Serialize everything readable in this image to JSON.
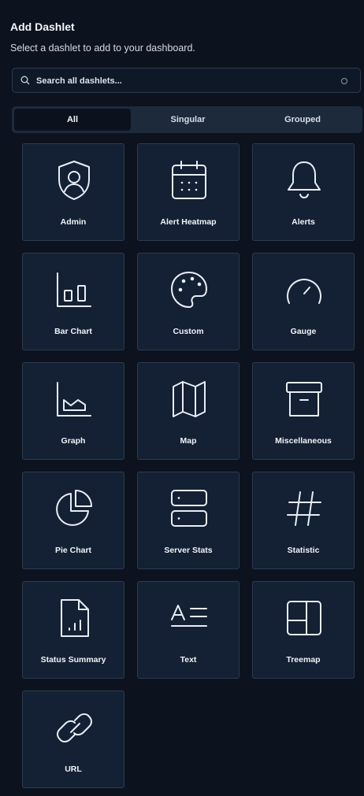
{
  "header": {
    "title": "Add Dashlet",
    "subtitle": "Select a dashlet to add to your dashboard."
  },
  "search": {
    "placeholder": "Search all dashlets...",
    "value": ""
  },
  "tabs": [
    {
      "label": "All",
      "active": true
    },
    {
      "label": "Singular",
      "active": false
    },
    {
      "label": "Grouped",
      "active": false
    }
  ],
  "dashlets": [
    {
      "label": "Admin",
      "icon": "admin-icon"
    },
    {
      "label": "Alert Heatmap",
      "icon": "calendar-icon"
    },
    {
      "label": "Alerts",
      "icon": "bell-icon"
    },
    {
      "label": "Bar Chart",
      "icon": "bar-chart-icon"
    },
    {
      "label": "Custom",
      "icon": "palette-icon"
    },
    {
      "label": "Gauge",
      "icon": "gauge-icon"
    },
    {
      "label": "Graph",
      "icon": "area-graph-icon"
    },
    {
      "label": "Map",
      "icon": "map-icon"
    },
    {
      "label": "Miscellaneous",
      "icon": "archive-box-icon"
    },
    {
      "label": "Pie Chart",
      "icon": "pie-chart-icon"
    },
    {
      "label": "Server Stats",
      "icon": "server-icon"
    },
    {
      "label": "Statistic",
      "icon": "hash-icon"
    },
    {
      "label": "Status Summary",
      "icon": "report-document-icon"
    },
    {
      "label": "Text",
      "icon": "text-icon"
    },
    {
      "label": "Treemap",
      "icon": "treemap-icon"
    },
    {
      "label": "URL",
      "icon": "link-icon"
    }
  ]
}
